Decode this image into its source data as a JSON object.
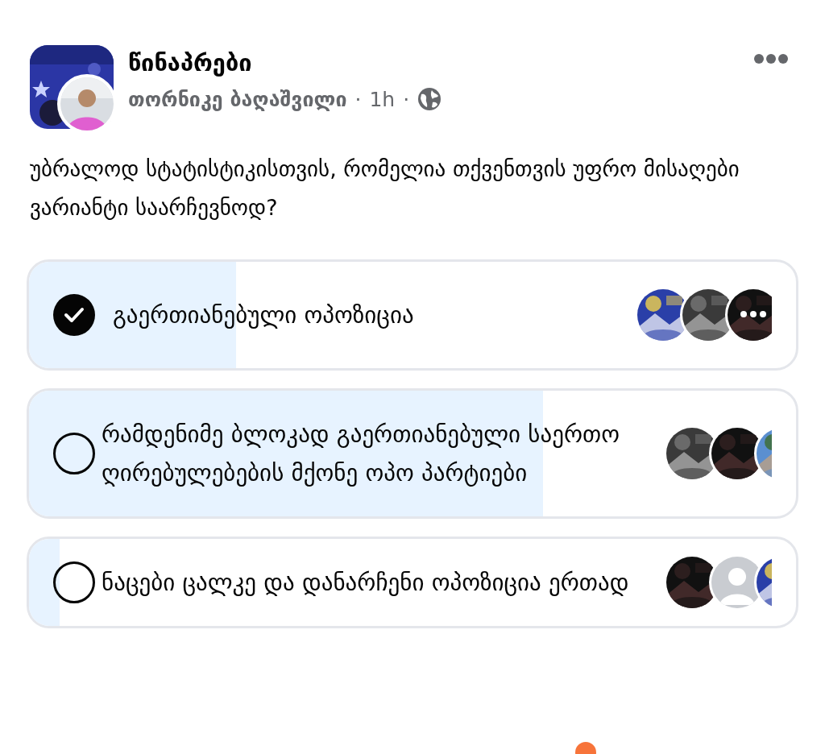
{
  "post": {
    "group": "წინაპრები",
    "author": "თორნიკე ბაღაშვილი",
    "time": "1h",
    "separator": "·"
  },
  "question": "უბრალოდ სტატისტიკისთვის, რომელია თქვენთვის უფრო მისაღები ვარიანტი საარჩევნოდ?",
  "options": [
    {
      "label": "გაერთიანებული ოპოზიცია",
      "selected": true,
      "level": 0.27,
      "more": true,
      "voters": [
        {
          "kind": "picture"
        },
        {
          "kind": "picture"
        },
        {
          "kind": "picture"
        }
      ]
    },
    {
      "label": "რამდენიმე ბლოკად გაერთიანებული საერთო ღირებულებების მქონე ოპო პარტიები",
      "selected": false,
      "level": 0.67,
      "more": false,
      "voters": [
        {
          "kind": "picture"
        },
        {
          "kind": "picture"
        },
        {
          "kind": "picture"
        }
      ]
    },
    {
      "label": "ნაცები ცალკე და დანარჩენი ოპოზიცია ერთად",
      "selected": false,
      "level": 0.04,
      "more": false,
      "voters": [
        {
          "kind": "picture"
        },
        {
          "kind": "placeholder"
        },
        {
          "kind": "picture"
        }
      ]
    }
  ]
}
